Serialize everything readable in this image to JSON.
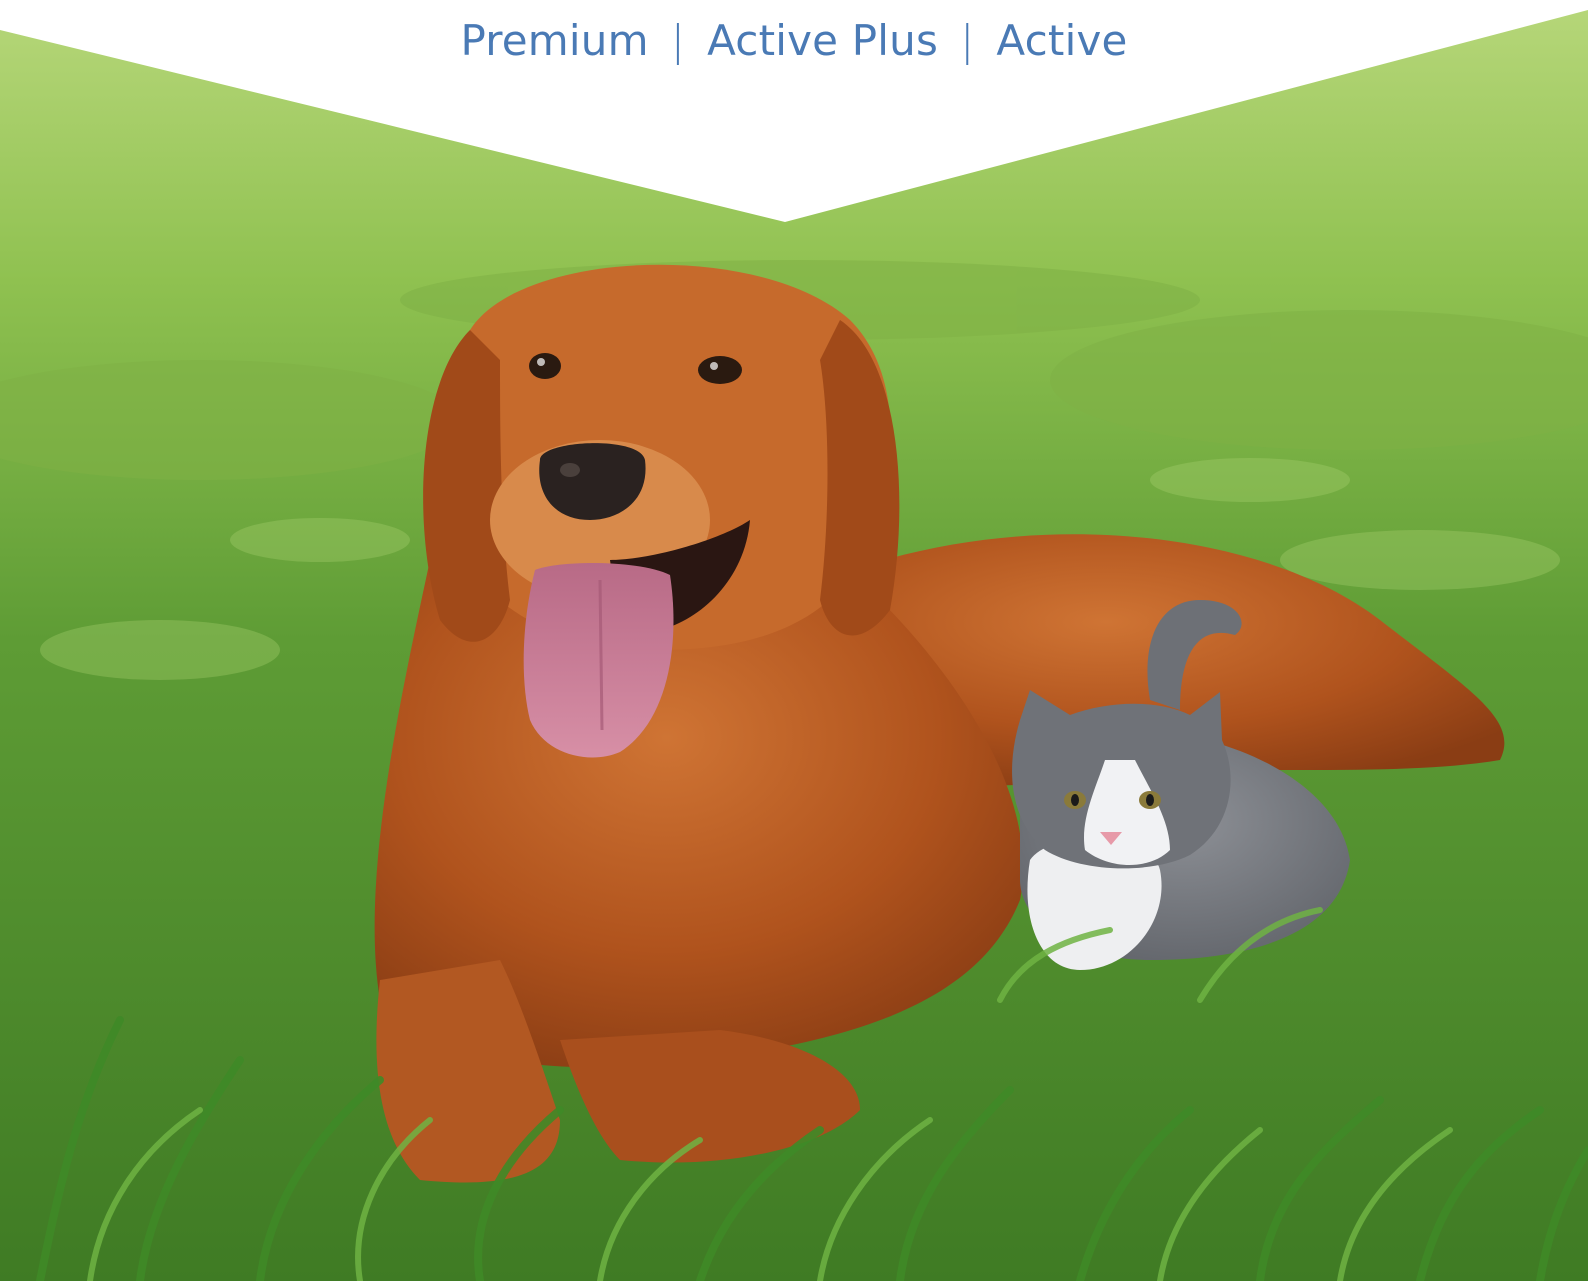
{
  "nav": {
    "plans": [
      {
        "label": "Premium"
      },
      {
        "label": "Active Plus"
      },
      {
        "label": "Active"
      }
    ],
    "separator": "|"
  },
  "colors": {
    "nav_text": "#4a7ab5",
    "banner_bg": "#ffffff",
    "grass": "#5f9a3a",
    "dog_fur": "#b4551f",
    "kitten_gray": "#777a80"
  }
}
